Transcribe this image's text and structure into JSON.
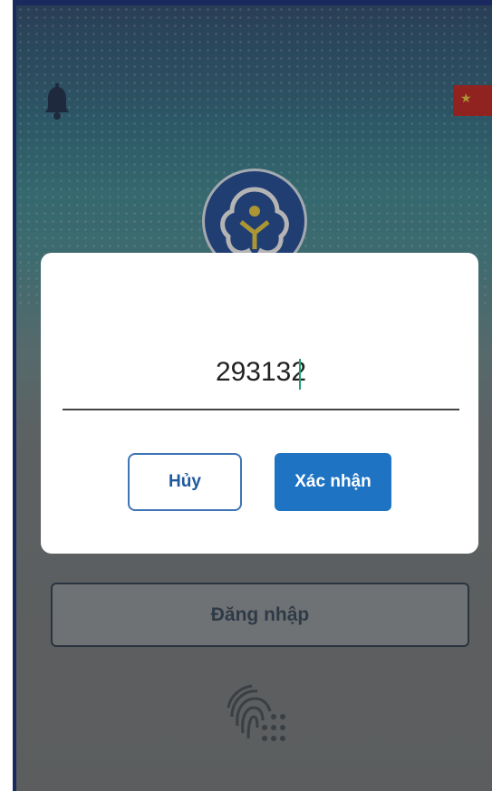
{
  "colors": {
    "primary": "#1e73c2",
    "flag_red": "#c8211d",
    "logo_blue": "#1d4a9a"
  },
  "header": {
    "notification_icon": "bell-icon",
    "language_icon": "vietnam-flag-icon"
  },
  "logo": {
    "icon": "vss-logo-icon"
  },
  "dialog": {
    "code_value": "293132",
    "cancel_label": "Hủy",
    "confirm_label": "Xác nhận"
  },
  "login": {
    "login_label": "Đăng nhập",
    "biometric_icon": "fingerprint-icon"
  }
}
